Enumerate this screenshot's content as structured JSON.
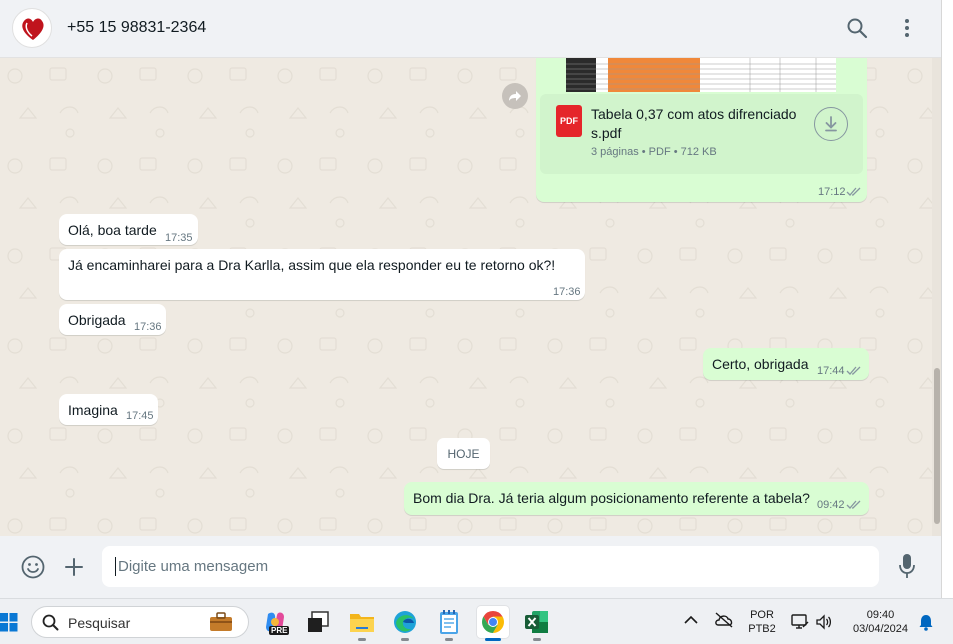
{
  "header": {
    "contact_name": "+55 15 98831-2364",
    "icons": [
      "search-icon",
      "menu-icon"
    ]
  },
  "attachment": {
    "file_name": "Tabela 0,37 com atos difrenciado s.pdf",
    "file_name_line1": "Tabela 0,37 com atos difrenciado",
    "file_name_line2": "s.pdf",
    "type_badge": "PDF",
    "meta": "3 páginas • PDF • 712 KB",
    "time": "17:12"
  },
  "messages": [
    {
      "dir": "in",
      "text": "Olá, boa tarde",
      "time": "17:35"
    },
    {
      "dir": "in",
      "text": "Já encaminharei para a Dra Karlla, assim que ela responder eu te retorno ok?!",
      "time": "17:36"
    },
    {
      "dir": "in",
      "text": "Obrigada",
      "time": "17:36"
    },
    {
      "dir": "out",
      "text": "Certo, obrigada",
      "time": "17:44"
    },
    {
      "dir": "in",
      "text": "Imagina",
      "time": "17:45"
    },
    {
      "dir": "out",
      "text": "Bom dia Dra. Já teria algum posicionamento referente a tabela?",
      "time": "09:42"
    }
  ],
  "day_divider": "HOJE",
  "composer": {
    "placeholder": "Digite uma mensagem",
    "icons": [
      "emoji-icon",
      "plus-icon",
      "microphone-icon"
    ]
  },
  "taskbar": {
    "search_label": "Pesquisar",
    "apps": [
      "briefcase-app",
      "copilot-app",
      "task-view-app",
      "file-explorer-app",
      "edge-app",
      "notepad-app",
      "chrome-app",
      "excel-app"
    ],
    "keyboard_lang": "POR",
    "keyboard_layout": "PTB2",
    "clock_time": "09:40",
    "clock_date": "03/04/2024",
    "copilot_badge": "PRE"
  }
}
